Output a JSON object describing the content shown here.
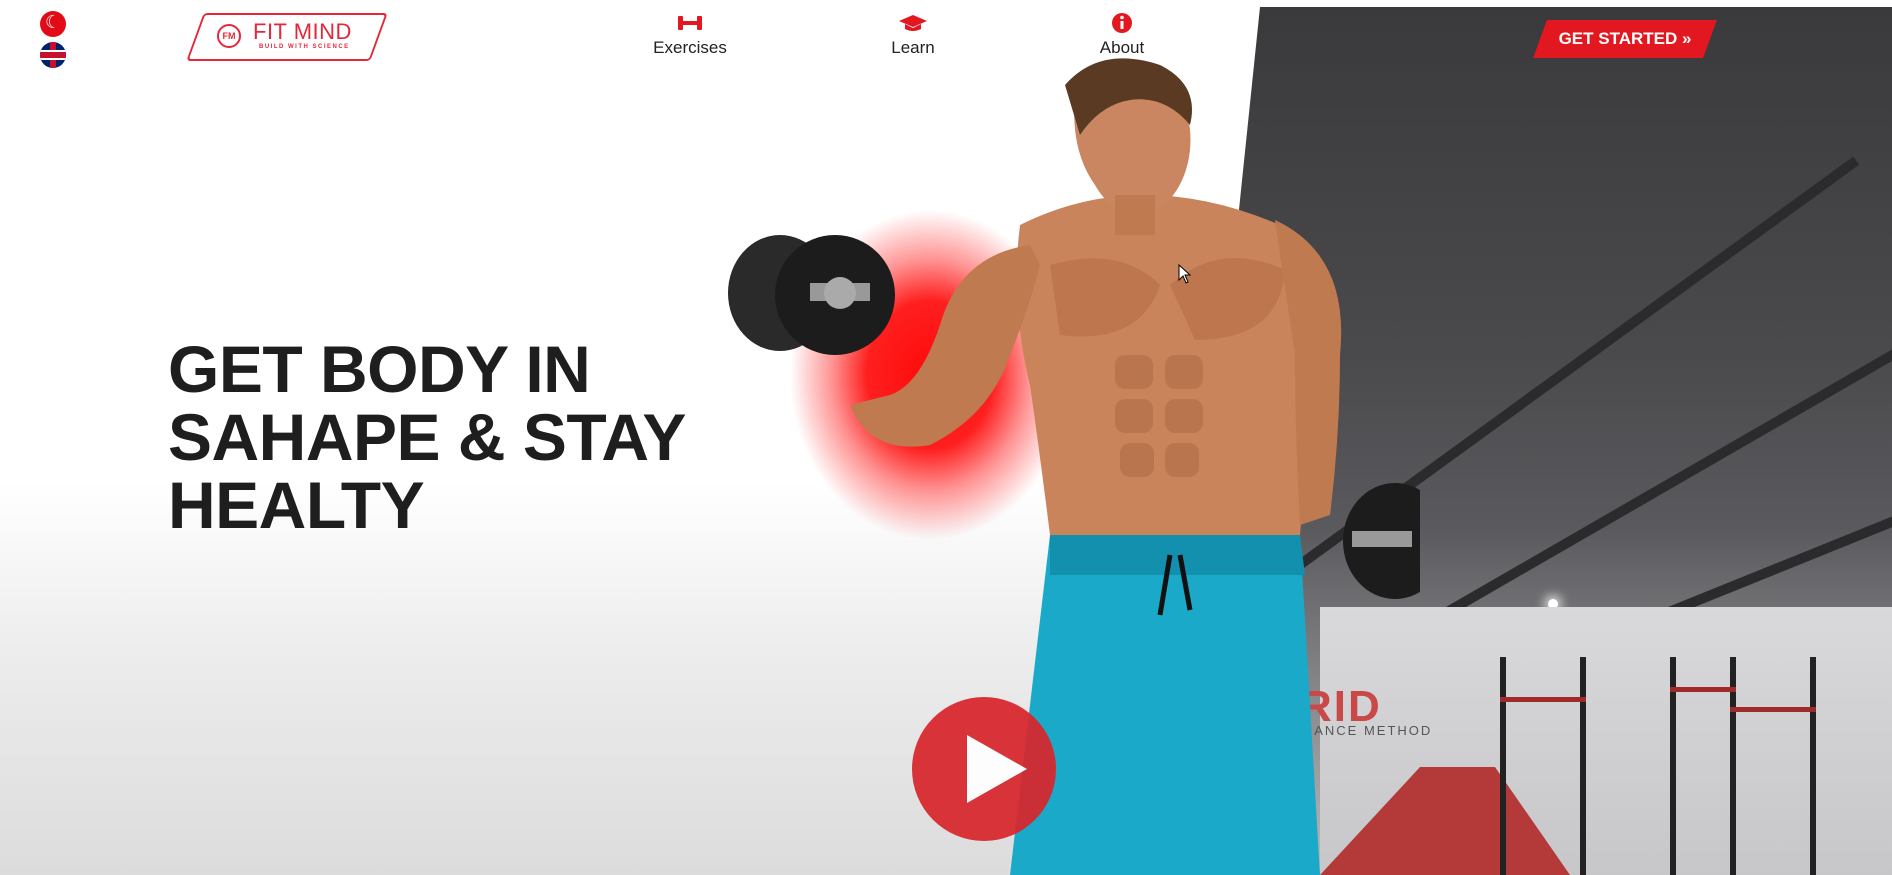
{
  "header": {
    "languages": [
      {
        "name": "Turkish"
      },
      {
        "name": "English"
      }
    ],
    "logo": {
      "title": "FIT MIND",
      "subtitle": "BUILD WITH SCIENCE",
      "badge": "FM"
    },
    "nav": [
      {
        "label": "Exercises",
        "icon": "dumbbell-icon"
      },
      {
        "label": "Learn",
        "icon": "graduation-cap-icon"
      },
      {
        "label": "About",
        "icon": "info-icon"
      }
    ],
    "cta": {
      "label": "GET STARTED »"
    }
  },
  "hero": {
    "headline_lines": [
      "GET BODY IN",
      "SAHAPE & STAY",
      "HEALTY"
    ],
    "gym_sign": {
      "title": "RID",
      "subtitle": "RMANCE METHOD"
    }
  },
  "colors": {
    "accent": "#e3171f",
    "text": "#1e1e1e",
    "shorts": "#1aa9c9"
  }
}
